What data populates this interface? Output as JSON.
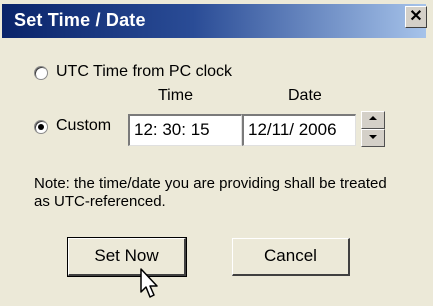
{
  "window": {
    "title": "Set Time / Date",
    "close_glyph": "✕"
  },
  "options": {
    "utc_label": "UTC Time from PC clock",
    "custom_label": "Custom",
    "selected": "custom"
  },
  "fields": {
    "time_header": "Time",
    "date_header": "Date",
    "time_value": "12: 30: 15",
    "date_value": "12/11/ 2006"
  },
  "note": "Note: the time/date you are providing shall be treated as UTC-referenced.",
  "buttons": {
    "set_now": "Set Now",
    "cancel": "Cancel"
  },
  "icons": {
    "close": "close-icon",
    "spin_up": "arrow-up-icon",
    "spin_down": "arrow-down-icon",
    "cursor": "mouse-pointer-icon"
  },
  "colors": {
    "title_start": "#0a246a",
    "title_end": "#a6c3ea",
    "dialog_bg": "#ece9d8"
  }
}
